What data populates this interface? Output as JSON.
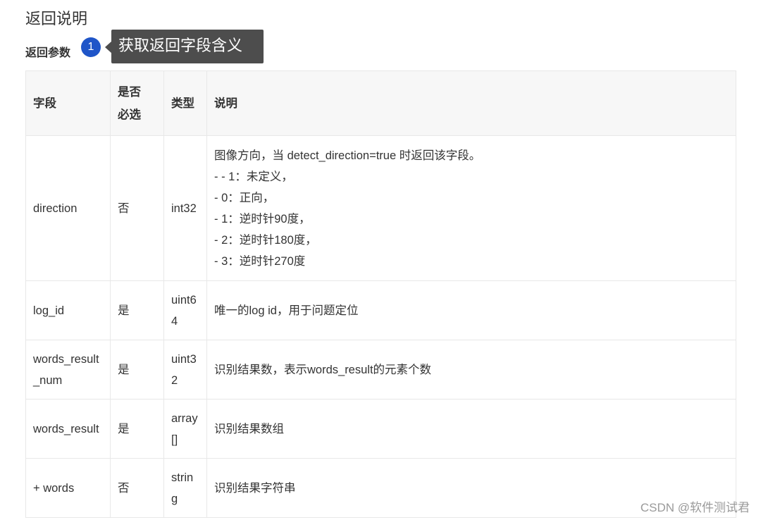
{
  "header": {
    "section_title": "返回说明",
    "sub_title": "返回参数",
    "step_number": "1",
    "tooltip_text": "获取返回字段含义"
  },
  "table": {
    "columns": {
      "field": "字段",
      "required_line1": "是否",
      "required_line2": "必选",
      "type": "类型",
      "desc": "说明"
    },
    "rows": [
      {
        "field": "direction",
        "required": "否",
        "type": "int32",
        "desc": [
          "图像方向，当 detect_direction=true 时返回该字段。",
          "- - 1：未定义，",
          "- 0：正向，",
          "- 1：逆时针90度，",
          "- 2：逆时针180度，",
          "- 3：逆时针270度"
        ]
      },
      {
        "field": "log_id",
        "required": "是",
        "type": "uint64",
        "desc": [
          "唯一的log id，用于问题定位"
        ]
      },
      {
        "field": "words_result_num",
        "required": "是",
        "type": "uint32",
        "desc": [
          "识别结果数，表示words_result的元素个数"
        ]
      },
      {
        "field": "words_result",
        "required": "是",
        "type": "array[]",
        "desc": [
          "识别结果数组"
        ]
      },
      {
        "field": "+ words",
        "required": "否",
        "type": "string",
        "desc": [
          "识别结果字符串"
        ]
      }
    ]
  },
  "watermark": "CSDN @软件测试君",
  "colors": {
    "badge": "#1f55c8",
    "tooltip": "#4d4d4d",
    "header_bg": "#f7f7f7",
    "border": "#e8e8e8"
  }
}
